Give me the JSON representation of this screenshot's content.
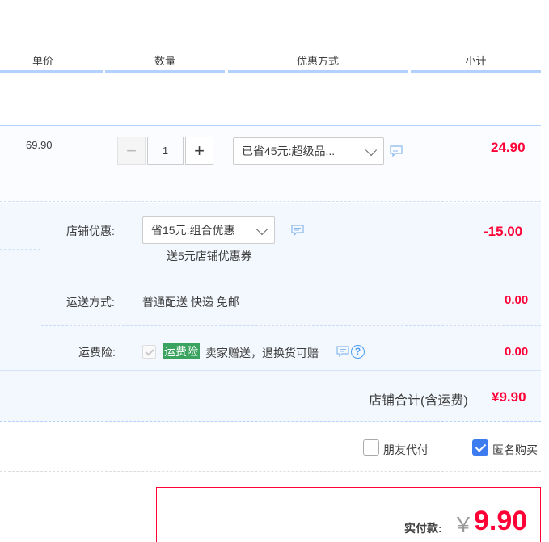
{
  "header": {
    "col_price": "单价",
    "col_qty": "数量",
    "col_discount": "优惠方式",
    "col_subtotal": "小计"
  },
  "item": {
    "unit_price": "69.90",
    "quantity": "1",
    "minus_label": "−",
    "plus_label": "+",
    "discount_select": "已省45元:超级品...",
    "subtotal": "24.90"
  },
  "shop": {
    "discount_label": "店铺优惠:",
    "discount_select": "省15元:组合优惠",
    "coupon_note": "送5元店铺优惠券",
    "discount_amount": "-15.00",
    "shipping_label": "运送方式:",
    "shipping_value": "普通配送 快递 免邮",
    "shipping_amount": "0.00",
    "insurance_label": "运费险:",
    "insurance_badge": "运费险",
    "insurance_text": "卖家赠送，退换货可赔",
    "insurance_amount": "0.00",
    "total_label": "店铺合计(含运费)",
    "total_amount": "¥9.90"
  },
  "options": {
    "friend_pay": "朋友代付",
    "anonymous": "匿名购买"
  },
  "payment": {
    "label": "实付款:",
    "currency": "￥",
    "amount": "9.90"
  },
  "colors": {
    "accent_red": "#ff0036",
    "header_line": "#b2d1ff",
    "checkbox_blue": "#3d7cf0",
    "insurance_green": "#3aa35f"
  }
}
